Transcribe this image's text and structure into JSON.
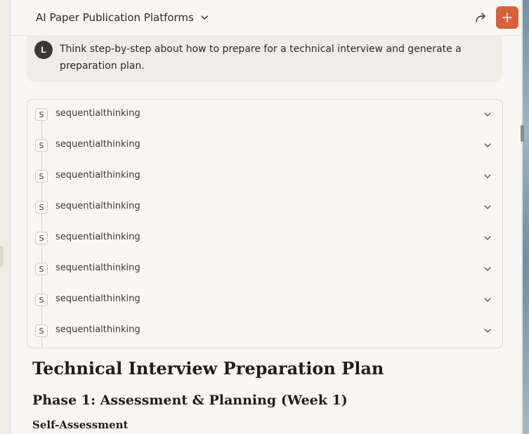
{
  "header": {
    "title": "AI Paper Publication Platforms",
    "icons": {
      "title_chevron": "chevron-down-icon",
      "share": "share-icon",
      "new_chat": "plus-icon"
    },
    "new_button_color": "#d8603b"
  },
  "prompt": {
    "avatar_initial": "L",
    "text": "Think step-by-step about how to prepare for a technical interview and generate a preparation plan."
  },
  "tool_calls": [
    {
      "badge": "S",
      "label": "sequentialthinking"
    },
    {
      "badge": "S",
      "label": "sequentialthinking"
    },
    {
      "badge": "S",
      "label": "sequentialthinking"
    },
    {
      "badge": "S",
      "label": "sequentialthinking"
    },
    {
      "badge": "S",
      "label": "sequentialthinking"
    },
    {
      "badge": "S",
      "label": "sequentialthinking"
    },
    {
      "badge": "S",
      "label": "sequentialthinking"
    },
    {
      "badge": "S",
      "label": "sequentialthinking"
    }
  ],
  "response": {
    "heading": "Technical Interview Preparation Plan",
    "phase_heading": "Phase 1: Assessment & Planning (Week 1)",
    "subheading": "Self-Assessment"
  }
}
